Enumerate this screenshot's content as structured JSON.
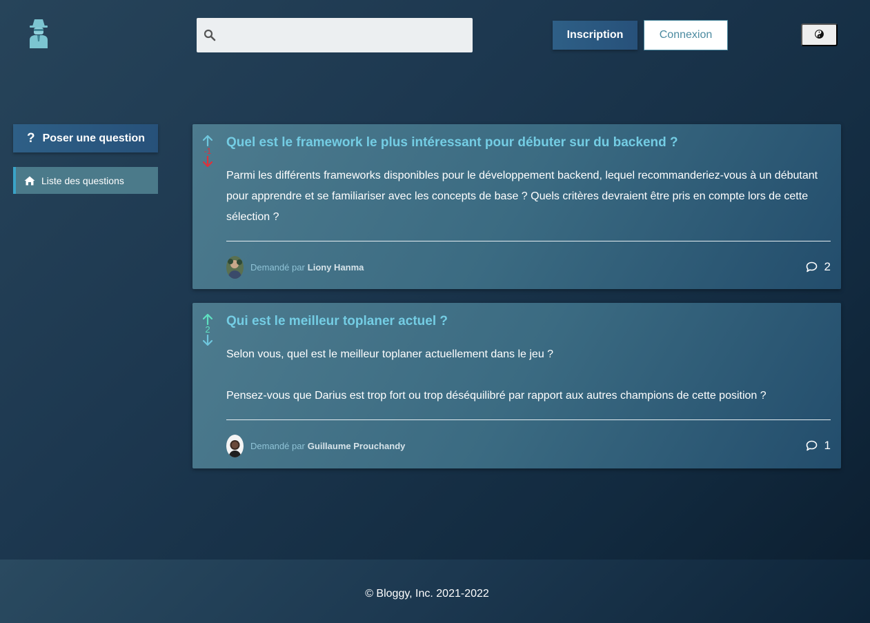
{
  "header": {
    "search": {
      "placeholder": "",
      "value": ""
    },
    "signup_label": "Inscription",
    "login_label": "Connexion",
    "icons": {
      "logo": "spy-icon",
      "search": "search-icon",
      "theme": "yin-yang-icon"
    }
  },
  "sidebar": {
    "ask_label": "Poser une question",
    "list_label": "Liste des questions",
    "icons": {
      "ask": "question-mark-icon",
      "list": "home-icon"
    }
  },
  "questions": [
    {
      "title": "Quel est le framework le plus intéressant pour débuter sur du backend ?",
      "body": "Parmi les différents frameworks disponibles pour le développement backend, lequel recommanderiez-vous à un débutant pour apprendre et se familiariser avec les concepts de base ? Quels critères devraient être pris en compte lors de cette sélection ?",
      "score": "-1",
      "asked_by_label": "Demandé par",
      "author": "Liony Hanma",
      "comment_count": "2"
    },
    {
      "title": "Qui est le meilleur toplaner actuel ?",
      "body_lines": [
        "Selon vous, quel est le meilleur toplaner actuellement dans le jeu ?",
        "Pensez-vous que Darius est trop fort ou trop déséquilibré par rapport aux autres champions de cette position ?"
      ],
      "score": "2",
      "asked_by_label": "Demandé par",
      "author": "Guillaume Prouchandy",
      "comment_count": "1"
    }
  ],
  "footer": {
    "copyright": "© Bloggy, Inc. 2021-2022"
  },
  "colors": {
    "accent": "#74cde4",
    "upvote_active": "#5ee0c0",
    "downvote_active": "#e0303a",
    "negative_score": "#e0303a",
    "positive_score": "#5ee0c0"
  }
}
